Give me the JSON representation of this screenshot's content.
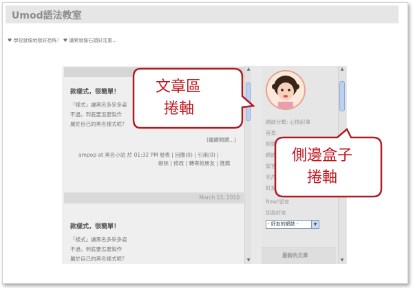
{
  "header": {
    "title": "Umod語法教室"
  },
  "marquee": {
    "text": "♥ 學校就像地獄好恐怖！ ♥ 讀累就像石頭好沈重..."
  },
  "main": {
    "posts": [
      {
        "title": "款樣式，很簡單！",
        "lines": [
          "「樣式」讓黑名多采多姿",
          "不過，到底要怎麼製作",
          "屬於自己的黑名樣式呢?"
        ],
        "read_more": "(繼續閱讀...)",
        "footer_line1": "ampop at 黑名小站 於 01:32 PM 發表 | 回應(0) | 引用(0) |",
        "footer_line2": "刪除 | 修改 | 轉寄給朋友 | 推薦"
      },
      {
        "date": "March 13, 2010",
        "title": "款樣式，很簡單！",
        "lines": [
          "「樣式」讓黑名多采多姿",
          "不過，到底要怎麼製作",
          "屬於自己的黑名樣式呢?"
        ]
      }
    ]
  },
  "sidebar": {
    "links": [
      "網誌分類: 心情記事",
      "首頁",
      "相簿",
      "網誌",
      "留言",
      "名片",
      "好友",
      "New!留言"
    ],
    "add_friend": "加為好友",
    "select_value": "- 好友的網誌 -",
    "box_title": "最新的文章"
  },
  "callouts": {
    "main_scroll": [
      "文章區",
      "捲軸"
    ],
    "side_scroll": [
      "側邊盒子",
      "捲軸"
    ]
  },
  "colors": {
    "callout_border": "#b01a22",
    "callout_text": "#c0151d"
  }
}
